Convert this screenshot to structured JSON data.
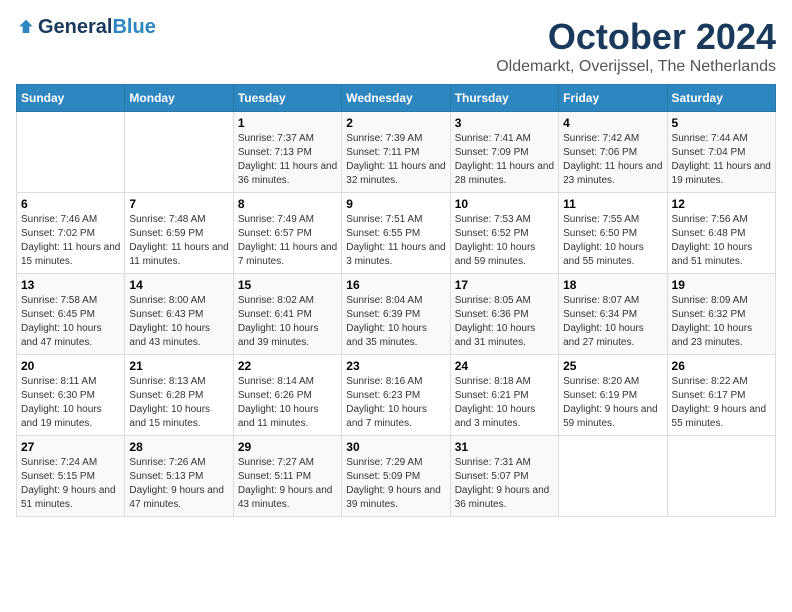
{
  "logo": {
    "general": "General",
    "blue": "Blue"
  },
  "header": {
    "month": "October 2024",
    "location": "Oldemarkt, Overijssel, The Netherlands"
  },
  "weekdays": [
    "Sunday",
    "Monday",
    "Tuesday",
    "Wednesday",
    "Thursday",
    "Friday",
    "Saturday"
  ],
  "weeks": [
    [
      {
        "day": null,
        "info": ""
      },
      {
        "day": null,
        "info": ""
      },
      {
        "day": "1",
        "info": "Sunrise: 7:37 AM\nSunset: 7:13 PM\nDaylight: 11 hours and 36 minutes."
      },
      {
        "day": "2",
        "info": "Sunrise: 7:39 AM\nSunset: 7:11 PM\nDaylight: 11 hours and 32 minutes."
      },
      {
        "day": "3",
        "info": "Sunrise: 7:41 AM\nSunset: 7:09 PM\nDaylight: 11 hours and 28 minutes."
      },
      {
        "day": "4",
        "info": "Sunrise: 7:42 AM\nSunset: 7:06 PM\nDaylight: 11 hours and 23 minutes."
      },
      {
        "day": "5",
        "info": "Sunrise: 7:44 AM\nSunset: 7:04 PM\nDaylight: 11 hours and 19 minutes."
      }
    ],
    [
      {
        "day": "6",
        "info": "Sunrise: 7:46 AM\nSunset: 7:02 PM\nDaylight: 11 hours and 15 minutes."
      },
      {
        "day": "7",
        "info": "Sunrise: 7:48 AM\nSunset: 6:59 PM\nDaylight: 11 hours and 11 minutes."
      },
      {
        "day": "8",
        "info": "Sunrise: 7:49 AM\nSunset: 6:57 PM\nDaylight: 11 hours and 7 minutes."
      },
      {
        "day": "9",
        "info": "Sunrise: 7:51 AM\nSunset: 6:55 PM\nDaylight: 11 hours and 3 minutes."
      },
      {
        "day": "10",
        "info": "Sunrise: 7:53 AM\nSunset: 6:52 PM\nDaylight: 10 hours and 59 minutes."
      },
      {
        "day": "11",
        "info": "Sunrise: 7:55 AM\nSunset: 6:50 PM\nDaylight: 10 hours and 55 minutes."
      },
      {
        "day": "12",
        "info": "Sunrise: 7:56 AM\nSunset: 6:48 PM\nDaylight: 10 hours and 51 minutes."
      }
    ],
    [
      {
        "day": "13",
        "info": "Sunrise: 7:58 AM\nSunset: 6:45 PM\nDaylight: 10 hours and 47 minutes."
      },
      {
        "day": "14",
        "info": "Sunrise: 8:00 AM\nSunset: 6:43 PM\nDaylight: 10 hours and 43 minutes."
      },
      {
        "day": "15",
        "info": "Sunrise: 8:02 AM\nSunset: 6:41 PM\nDaylight: 10 hours and 39 minutes."
      },
      {
        "day": "16",
        "info": "Sunrise: 8:04 AM\nSunset: 6:39 PM\nDaylight: 10 hours and 35 minutes."
      },
      {
        "day": "17",
        "info": "Sunrise: 8:05 AM\nSunset: 6:36 PM\nDaylight: 10 hours and 31 minutes."
      },
      {
        "day": "18",
        "info": "Sunrise: 8:07 AM\nSunset: 6:34 PM\nDaylight: 10 hours and 27 minutes."
      },
      {
        "day": "19",
        "info": "Sunrise: 8:09 AM\nSunset: 6:32 PM\nDaylight: 10 hours and 23 minutes."
      }
    ],
    [
      {
        "day": "20",
        "info": "Sunrise: 8:11 AM\nSunset: 6:30 PM\nDaylight: 10 hours and 19 minutes."
      },
      {
        "day": "21",
        "info": "Sunrise: 8:13 AM\nSunset: 6:28 PM\nDaylight: 10 hours and 15 minutes."
      },
      {
        "day": "22",
        "info": "Sunrise: 8:14 AM\nSunset: 6:26 PM\nDaylight: 10 hours and 11 minutes."
      },
      {
        "day": "23",
        "info": "Sunrise: 8:16 AM\nSunset: 6:23 PM\nDaylight: 10 hours and 7 minutes."
      },
      {
        "day": "24",
        "info": "Sunrise: 8:18 AM\nSunset: 6:21 PM\nDaylight: 10 hours and 3 minutes."
      },
      {
        "day": "25",
        "info": "Sunrise: 8:20 AM\nSunset: 6:19 PM\nDaylight: 9 hours and 59 minutes."
      },
      {
        "day": "26",
        "info": "Sunrise: 8:22 AM\nSunset: 6:17 PM\nDaylight: 9 hours and 55 minutes."
      }
    ],
    [
      {
        "day": "27",
        "info": "Sunrise: 7:24 AM\nSunset: 5:15 PM\nDaylight: 9 hours and 51 minutes."
      },
      {
        "day": "28",
        "info": "Sunrise: 7:26 AM\nSunset: 5:13 PM\nDaylight: 9 hours and 47 minutes."
      },
      {
        "day": "29",
        "info": "Sunrise: 7:27 AM\nSunset: 5:11 PM\nDaylight: 9 hours and 43 minutes."
      },
      {
        "day": "30",
        "info": "Sunrise: 7:29 AM\nSunset: 5:09 PM\nDaylight: 9 hours and 39 minutes."
      },
      {
        "day": "31",
        "info": "Sunrise: 7:31 AM\nSunset: 5:07 PM\nDaylight: 9 hours and 36 minutes."
      },
      {
        "day": null,
        "info": ""
      },
      {
        "day": null,
        "info": ""
      }
    ]
  ]
}
